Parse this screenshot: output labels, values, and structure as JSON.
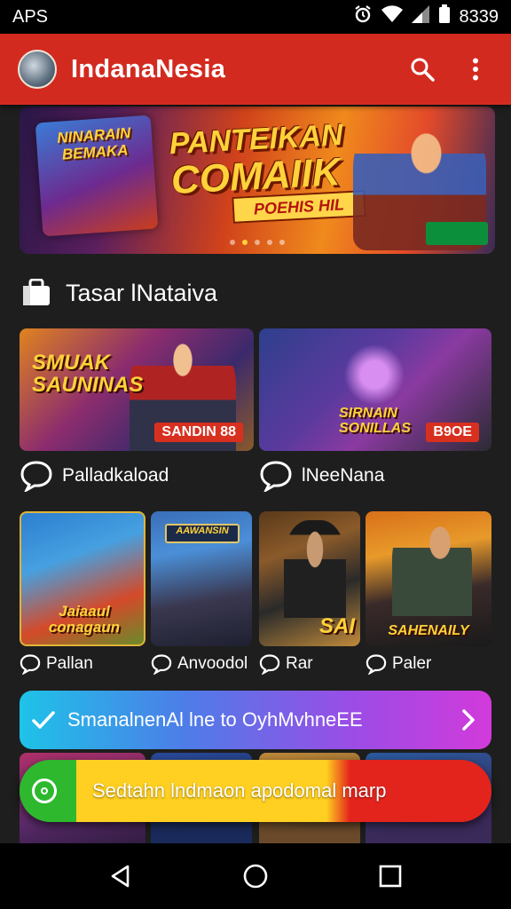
{
  "status_bar": {
    "left_text": "APS",
    "right_text": "8339",
    "icons": [
      "alarm-icon",
      "wifi-icon",
      "signal-icon",
      "battery-icon"
    ]
  },
  "app_bar": {
    "title": "IndanaNesia",
    "logo_icon": "app-logo",
    "actions": [
      "search-icon",
      "more-vert-icon"
    ],
    "color": "#d32a20"
  },
  "hero_banner": {
    "poster_text": "NINARAIN BEMAKA",
    "title_line1": "PANTEIKAN",
    "title_line2": "COMAIIK",
    "ribbon": "POEHIS HIL",
    "dots": 5,
    "active_dot": 1
  },
  "section": {
    "icon": "bag-icon",
    "title": "Tasar lNataiva"
  },
  "featured": [
    {
      "thumb_title": "SMUAK SAUNINAS",
      "thumb_tag": "SANDIN 88",
      "caption": "Palladkaload",
      "caption_icon": "chat-bubble-icon"
    },
    {
      "thumb_title": "SIRNAIN SONILLAS",
      "thumb_tag": "B9OE",
      "caption": "lNeeNana",
      "caption_icon": "chat-bubble-icon"
    }
  ],
  "grid": [
    {
      "thumb_title": "Jaiaaul conagaun",
      "caption": "Pallan"
    },
    {
      "thumb_title": "AAWANSIN",
      "caption": "Anvoodol"
    },
    {
      "thumb_title": "SAI",
      "caption": "Rar"
    },
    {
      "thumb_title": "SAHENAILY",
      "caption": "Paler"
    }
  ],
  "promo_banner": {
    "text": "SmanalnenAl lne to OyhMvhneEE",
    "left_icon": "check-icon",
    "right_icon": "chevron-right-icon"
  },
  "toast": {
    "text": "Sedtahn lndmaon apodomal marp",
    "icon": "toast-status-icon"
  },
  "nav_bar": {
    "buttons": [
      "back-icon",
      "home-icon",
      "recents-icon"
    ]
  }
}
